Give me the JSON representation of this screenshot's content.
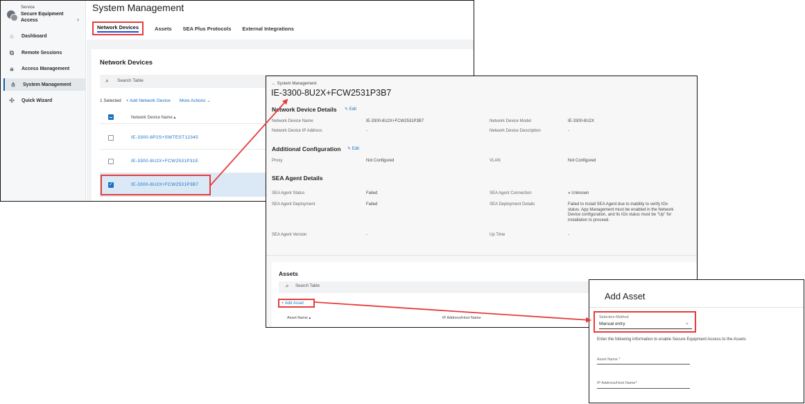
{
  "screen1": {
    "sidebar": {
      "service_label": "Service",
      "product_name": "Secure Equipment Access",
      "items": [
        {
          "label": "Dashboard",
          "icon": "dashboard-icon"
        },
        {
          "label": "Remote Sessions",
          "icon": "remote-sessions-icon"
        },
        {
          "label": "Access Management",
          "icon": "lock-icon"
        },
        {
          "label": "System Management",
          "icon": "system-management-icon",
          "active": true
        },
        {
          "label": "Quick Wizard",
          "icon": "quick-wizard-icon"
        }
      ]
    },
    "page_title": "System Management",
    "tabs": [
      "Network Devices",
      "Assets",
      "SEA Plus Protocols",
      "External Integrations"
    ],
    "active_tab": "Network Devices",
    "section_title": "Network Devices",
    "search_placeholder": "Search Table",
    "selected_count": "1 Selected",
    "add_device_label": "+ Add Network Device",
    "more_actions_label": "More Actions",
    "column_header": "Network Device Name",
    "rows": [
      {
        "name": "IE-3300-8P2S+SWTEST12345",
        "checked": false
      },
      {
        "name": "IE-3300-8U2X+FCW2531P31E",
        "checked": false
      },
      {
        "name": "IE-3300-8U2X+FCW2531P3B7",
        "checked": true
      }
    ]
  },
  "screen2": {
    "breadcrumb": "← System Management",
    "device_title": "IE-3300-8U2X+FCW2531P3B7",
    "edit_label": "Edit",
    "network_device_details": {
      "title": "Network Device Details",
      "name_label": "Network Device Name",
      "name_value": "IE-3300-8U2X+FCW2531P3B7",
      "model_label": "Network Device Model",
      "model_value": "IE-3300-8U2X",
      "ip_label": "Network Device IP Address",
      "ip_value": "-",
      "desc_label": "Network Device Description",
      "desc_value": "-"
    },
    "additional_configuration": {
      "title": "Additional Configuration",
      "proxy_label": "Proxy",
      "proxy_value": "Not Configured",
      "vlan_label": "VLAN",
      "vlan_value": "Not Configured"
    },
    "sea_agent_details": {
      "title": "SEA Agent Details",
      "status_label": "SEA Agent Status",
      "status_value": "Failed",
      "connection_label": "SEA Agent Connection",
      "connection_value": "Unknown",
      "deployment_label": "SEA Agent Deployment",
      "deployment_value": "Failed",
      "deployment_details_label": "SEA Deployment Details",
      "deployment_details_value": "Failed to install SEA Agent due to inability to verify IOx status. App Management must be enabled in the Network Device configuration, and its IOx status must be \"Up\" for installation to proceed.",
      "version_label": "SEA Agent Version",
      "version_value": "-",
      "uptime_label": "Up Time",
      "uptime_value": "-"
    },
    "assets": {
      "title": "Assets",
      "search_placeholder": "Search Table",
      "add_asset_label": "+ Add Asset",
      "col_asset_name": "Asset Name",
      "col_ip": "IP Address/Host Name"
    }
  },
  "screen3": {
    "title": "Add Asset",
    "selection_label": "Selection Method",
    "selection_value": "Manual entry",
    "info_text": "Enter the following information to enable Secure Equipment Access to the Assets",
    "asset_name_label": "Asset Name *",
    "ip_label": "IP Address/Host Name*"
  },
  "colors": {
    "highlight_red": "#e83a3a",
    "link_blue": "#1a6fc4",
    "selected_row": "#dbe9f7"
  }
}
